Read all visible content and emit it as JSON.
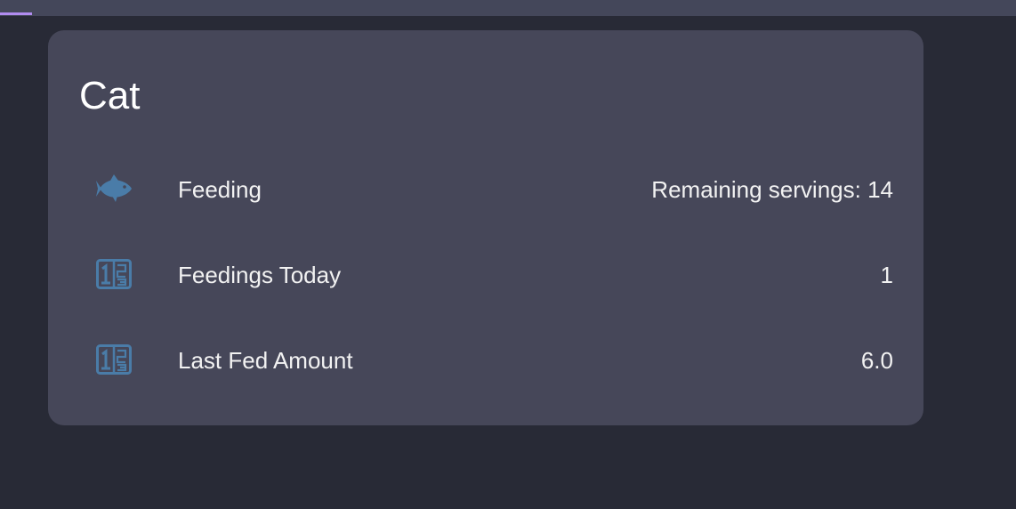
{
  "colors": {
    "background": "#282a36",
    "topbar": "#44475a",
    "tab_indicator": "#b18cf0",
    "card_background": "#464759",
    "icon": "#4a7ca8"
  },
  "card": {
    "title": "Cat",
    "entities": [
      {
        "icon": "fish-icon",
        "name": "Feeding",
        "state": "Remaining servings: 14"
      },
      {
        "icon": "numeric-icon",
        "name": "Feedings Today",
        "state": "1"
      },
      {
        "icon": "numeric-icon",
        "name": "Last Fed Amount",
        "state": "6.0"
      }
    ]
  }
}
